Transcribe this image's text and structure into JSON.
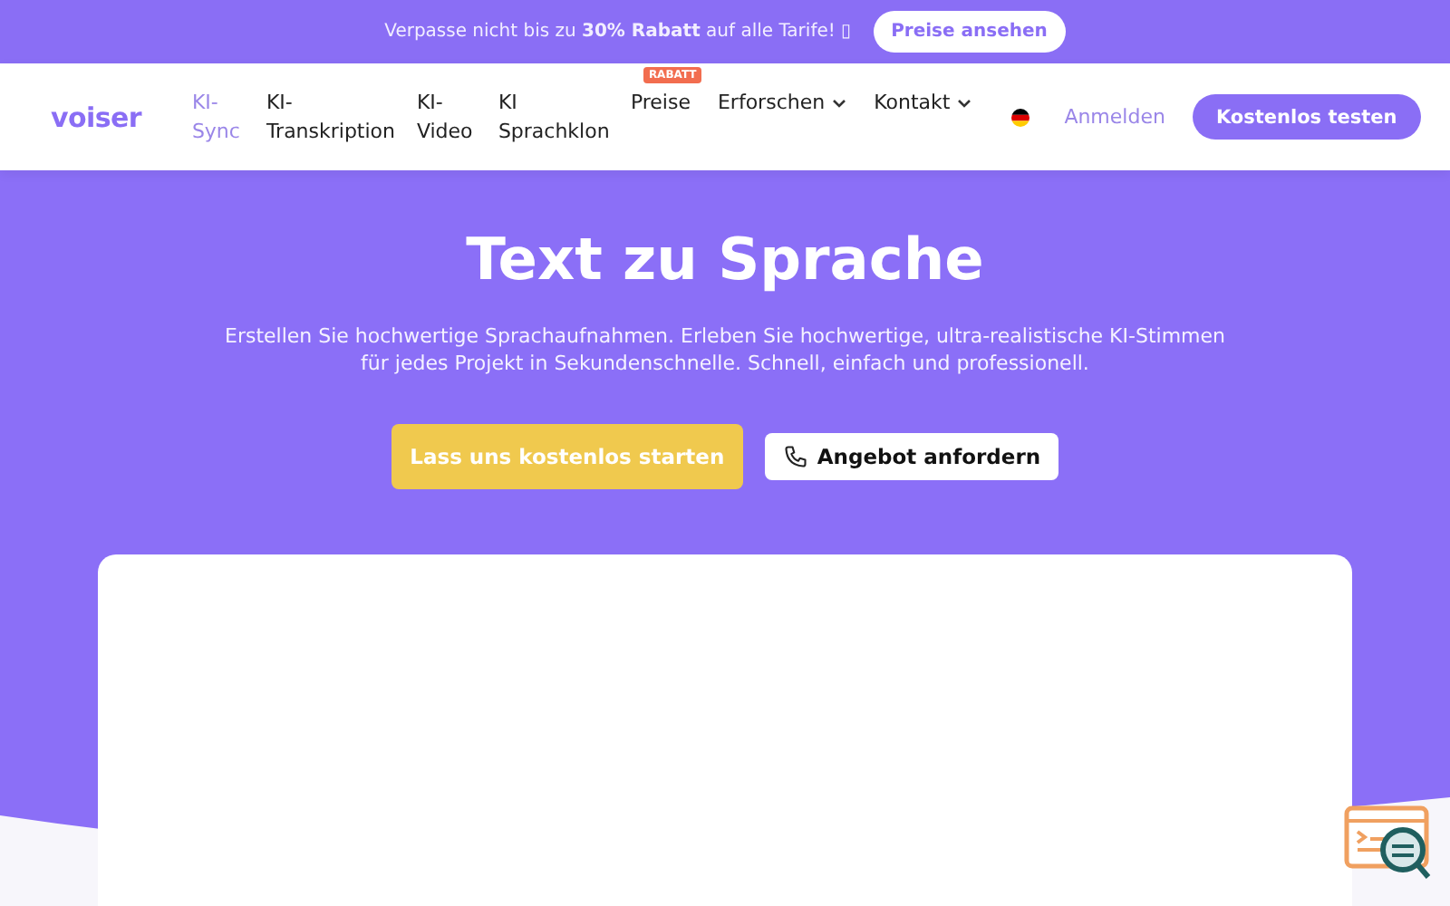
{
  "promo_bar": {
    "text": "Verpasse nicht bis zu **30% Rabatt** auf alle Tarife! ▯",
    "button": "Preise ansehen"
  },
  "nav": {
    "logo": "voiser",
    "items": [
      {
        "label": "KI-Sync",
        "selected": true,
        "dropdown": false
      },
      {
        "label": "KI-Transkription",
        "selected": false,
        "dropdown": false
      },
      {
        "label": "KI-Video",
        "selected": false,
        "dropdown": false
      },
      {
        "label": "KI Sprachklon",
        "selected": false,
        "dropdown": false
      },
      {
        "label": "Preise",
        "selected": false,
        "dropdown": false,
        "badge": "RABATT"
      },
      {
        "label": "Erforschen",
        "selected": false,
        "dropdown": true
      },
      {
        "label": "Kontakt",
        "selected": false,
        "dropdown": true
      }
    ],
    "login": "Anmelden",
    "cta": "Kostenlos testen"
  },
  "hero": {
    "title": "Text zu Sprache",
    "subtitle": "Erstellen Sie hochwertige Sprachaufnahmen. Erleben Sie hochwertige, ultra-realistische KI-Stimmen für jedes Projekt in Sekundenschnelle. Schnell, einfach und professionell.",
    "primary_button": "Lass uns kostenlos starten",
    "secondary_button": "Angebot anfordern"
  }
}
